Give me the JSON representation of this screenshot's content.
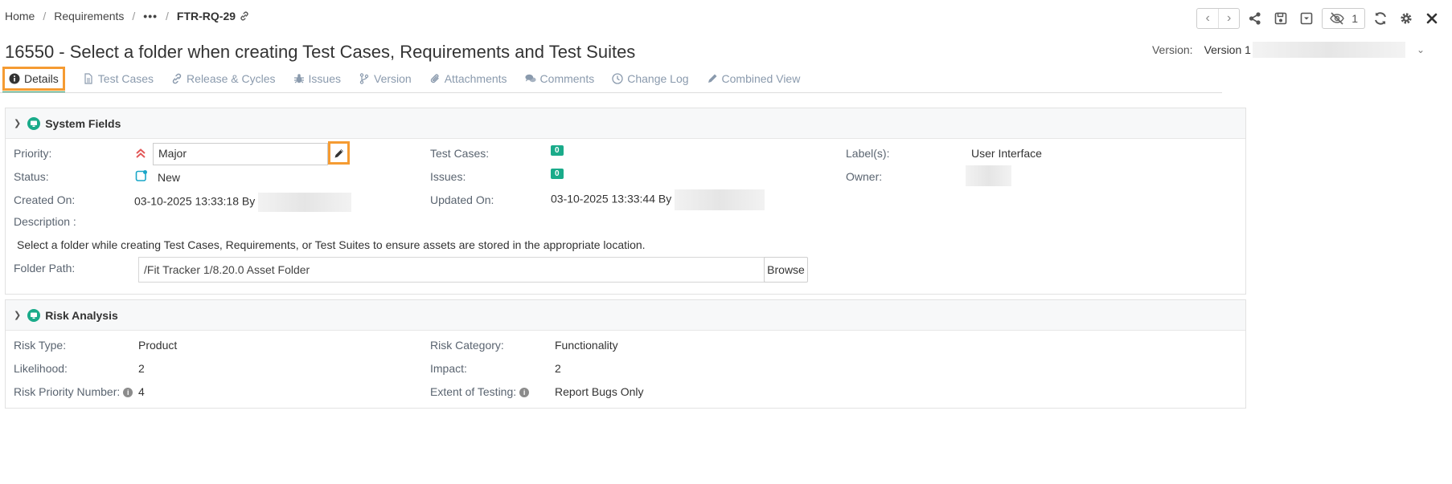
{
  "breadcrumb": {
    "home": "Home",
    "requirements": "Requirements",
    "more": "•••",
    "current": "FTR-RQ-29"
  },
  "toolbar": {
    "watch_count": "1"
  },
  "title": "16550 - Select a folder when creating Test Cases, Requirements and Test Suites",
  "version": {
    "label": "Version:",
    "value": "Version 1"
  },
  "tabs": [
    "Details",
    "Test Cases",
    "Release & Cycles",
    "Issues",
    "Version",
    "Attachments",
    "Comments",
    "Change Log",
    "Combined View"
  ],
  "system_fields": {
    "heading": "System Fields",
    "priority_label": "Priority:",
    "priority_value": "Major",
    "status_label": "Status:",
    "status_value": "New",
    "created_label": "Created On:",
    "created_value": "03-10-2025 13:33:18 By",
    "description_label": "Description :",
    "description_text": "Select a folder while creating Test Cases, Requirements, or Test Suites to ensure assets are stored in the appropriate location.",
    "folder_label": "Folder Path:",
    "folder_value": "/Fit Tracker 1/8.20.0 Asset Folder",
    "browse_label": "Browse",
    "test_cases_label": "Test Cases:",
    "test_cases_count": "0",
    "issues_label": "Issues:",
    "issues_count": "0",
    "updated_label": "Updated On:",
    "updated_value": "03-10-2025 13:33:44 By",
    "labels_label": "Label(s):",
    "labels_value": "User Interface",
    "owner_label": "Owner:"
  },
  "risk_analysis": {
    "heading": "Risk Analysis",
    "risk_type_label": "Risk Type:",
    "risk_type_value": "Product",
    "likelihood_label": "Likelihood:",
    "likelihood_value": "2",
    "rpn_label": "Risk Priority Number:",
    "rpn_value": "4",
    "risk_category_label": "Risk Category:",
    "risk_category_value": "Functionality",
    "impact_label": "Impact:",
    "impact_value": "2",
    "extent_label": "Extent of Testing:",
    "extent_value": "Report Bugs Only"
  },
  "colors": {
    "accent_highlight": "#f59b32",
    "badge": "#1aab8a",
    "tab_inactive": "#8a9aad",
    "priority_icon": "#e25858"
  },
  "icons": [
    "link-icon",
    "chevron-left-icon",
    "chevron-right-icon",
    "share-icon",
    "save-icon",
    "dropdown-box-icon",
    "eye-slash-icon",
    "refresh-icon",
    "gear-icon",
    "close-icon",
    "info-icon",
    "file-icon",
    "link-icon",
    "bug-icon",
    "branch-icon",
    "paperclip-icon",
    "comments-icon",
    "clock-icon",
    "pencil-icon",
    "monitor-icon",
    "double-chevron-up-icon",
    "status-new-icon"
  ]
}
